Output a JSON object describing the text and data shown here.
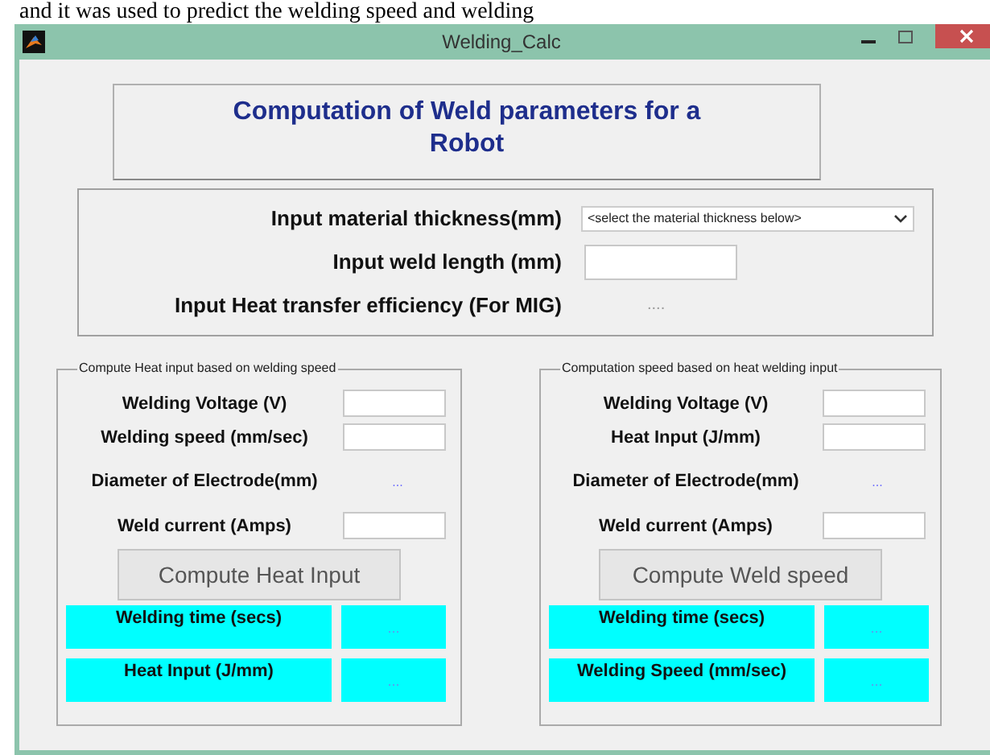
{
  "caption": "and it was used to predict the welding speed and welding",
  "window": {
    "title": "Welding_Calc"
  },
  "heading": "Computation of Weld parameters for a Robot",
  "main_rows": [
    {
      "kind": "select",
      "label": "Input material thickness(mm)",
      "value": "<select the material thickness below>"
    },
    {
      "kind": "field",
      "label": "Input weld length (mm)"
    },
    {
      "kind": "readout",
      "label": "Input Heat transfer efficiency (For MIG)",
      "value": "...."
    }
  ],
  "groups": [
    {
      "title": "Compute Heat input based on welding speed",
      "rows": [
        {
          "kind": "field",
          "label": "Welding Voltage (V)"
        },
        {
          "kind": "field",
          "label": "Welding speed (mm/sec)"
        },
        {
          "kind": "readout",
          "label": "Diameter of Electrode(mm)",
          "value": "..."
        },
        {
          "kind": "field",
          "label": "Weld current (Amps)"
        }
      ],
      "button": "Compute Heat Input",
      "outputs": [
        {
          "label": "Welding time (secs)",
          "value": "..."
        },
        {
          "label": "Heat Input (J/mm)",
          "value": "..."
        }
      ]
    },
    {
      "title": "Computation speed based on heat welding input",
      "rows": [
        {
          "kind": "field",
          "label": "Welding Voltage (V)"
        },
        {
          "kind": "field",
          "label": "Heat Input (J/mm)"
        },
        {
          "kind": "readout",
          "label": "Diameter of Electrode(mm)",
          "value": "..."
        },
        {
          "kind": "field",
          "label": "Weld current (Amps)"
        }
      ],
      "button": "Compute Weld speed",
      "outputs": [
        {
          "label": "Welding time (secs)",
          "value": "..."
        },
        {
          "label": "Welding Speed (mm/sec)",
          "value": "..."
        }
      ]
    }
  ]
}
